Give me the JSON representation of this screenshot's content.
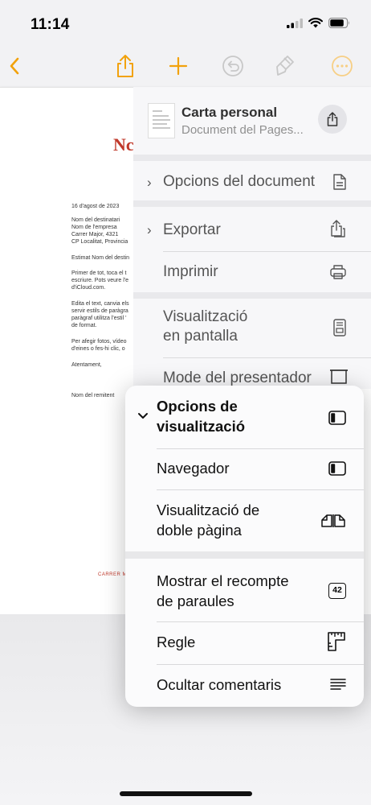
{
  "status_bar": {
    "time": "11:14"
  },
  "colors": {
    "accent": "#f2a20c",
    "doc_red": "#c0392b"
  },
  "toolbar": {
    "icons": [
      "back-chevron-icon",
      "share-icon",
      "add-icon",
      "undo-icon",
      "format-brush-icon",
      "more-icon"
    ]
  },
  "document": {
    "title": "Nc",
    "lines": [
      "16 d'agost de 2023",
      "Nom del destinatari",
      "Nom de l'empresa",
      "Carrer Major, 4321",
      "CP Localitat, Provincia",
      "Estimat Nom del destin",
      "Primer de tot, toca el t",
      "escriure. Pots veure l'e",
      "d'iCloud.com.",
      "Edita el text, canvia els",
      "servir estils de paràgra",
      "paràgraf utilitza l'estil '",
      "de format.",
      "Per afegir fotos, vídeo",
      "d'eines o fes-hi clic, o",
      "Atentament,",
      "Nom del remitent"
    ],
    "footer": "CARRER M"
  },
  "file_menu": {
    "doc_name": "Carta personal",
    "doc_type": "Document del Pages...",
    "items": [
      {
        "label": "Opcions del document"
      },
      {
        "label": "Exportar"
      },
      {
        "label": "Imprimir"
      },
      {
        "label": "Visualització en pantalla",
        "line1": "Visualització",
        "line2": "en pantalla"
      },
      {
        "label": "Mode del presentador"
      }
    ]
  },
  "view_menu": {
    "header": {
      "line1": "Opcions de",
      "line2": "visualització"
    },
    "items": [
      {
        "label": "Navegador"
      },
      {
        "line1": "Visualització de",
        "line2": "doble pàgina"
      },
      {
        "line1": "Mostrar el recompte",
        "line2": "de paraules",
        "badge": "42"
      },
      {
        "label": "Regle"
      },
      {
        "label": "Ocultar comentaris"
      }
    ]
  }
}
